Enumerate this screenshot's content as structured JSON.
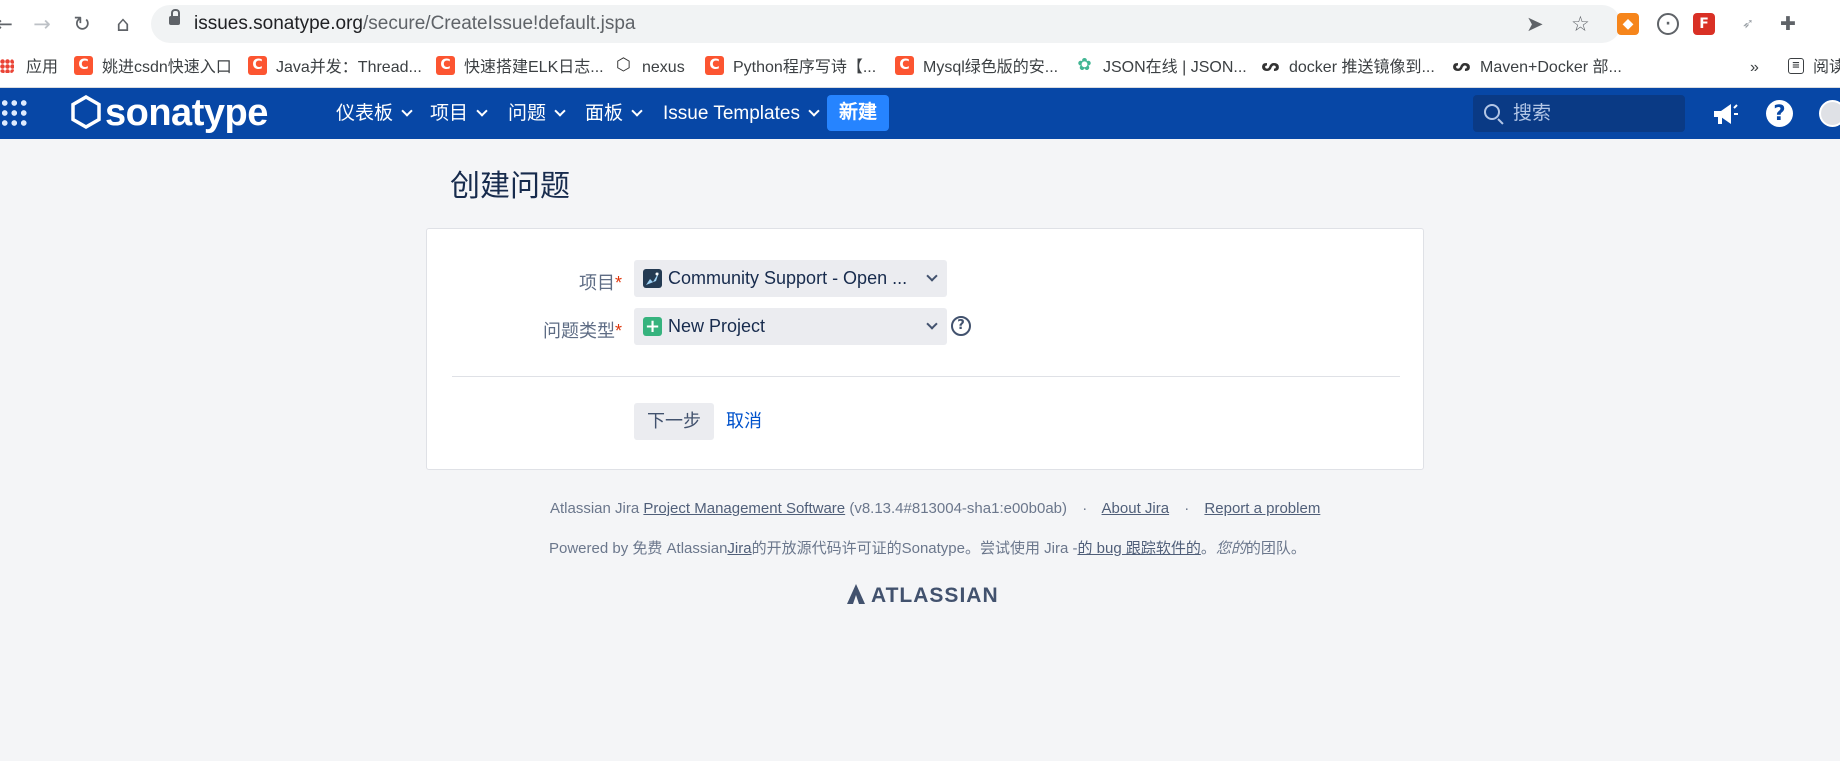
{
  "browser": {
    "url_host": "issues.sonatype.org",
    "url_path": "/secure/CreateIssue!default.jspa",
    "bookmarks": [
      "应用",
      "姚进csdn快速入口",
      "Java并发：Thread...",
      "快速搭建ELK日志...",
      "nexus",
      "Python程序写诗【...",
      "Mysql绿色版的安...",
      "JSON在线 | JSON...",
      "docker 推送镜像到...",
      "Maven+Docker 部...",
      "»",
      "阅读"
    ]
  },
  "header": {
    "logo": "sonatype",
    "menu": [
      "仪表板",
      "项目",
      "问题",
      "面板",
      "Issue Templates"
    ],
    "create_label": "新建",
    "search_placeholder": "搜索",
    "help": "?"
  },
  "page": {
    "title": "创建问题",
    "project_label": "项目",
    "project_value": "Community Support - Open ...",
    "type_label": "问题类型",
    "type_value": "New Project",
    "required_mark": "*",
    "help_mark": "?",
    "next_label": "下一步",
    "cancel_label": "取消"
  },
  "footer": {
    "line1_prefix": "Atlassian Jira",
    "line1_link": "Project Management Software",
    "line1_version": "(v8.13.4#813004-sha1:e00b0ab)",
    "about": "About Jira",
    "report": "Report a problem",
    "separator": "·",
    "powered_prefix": "Powered by 免费 Atlassian",
    "powered_jira": "Jira",
    "powered_mid": "的开放源代码许可证的Sonatype。尝试使用 Jira -",
    "powered_link": "的 bug 跟踪软件的",
    "powered_end": "。",
    "powered_italic": "您的",
    "powered_tail": "的团队。",
    "atlassian": "ATLASSIAN"
  }
}
